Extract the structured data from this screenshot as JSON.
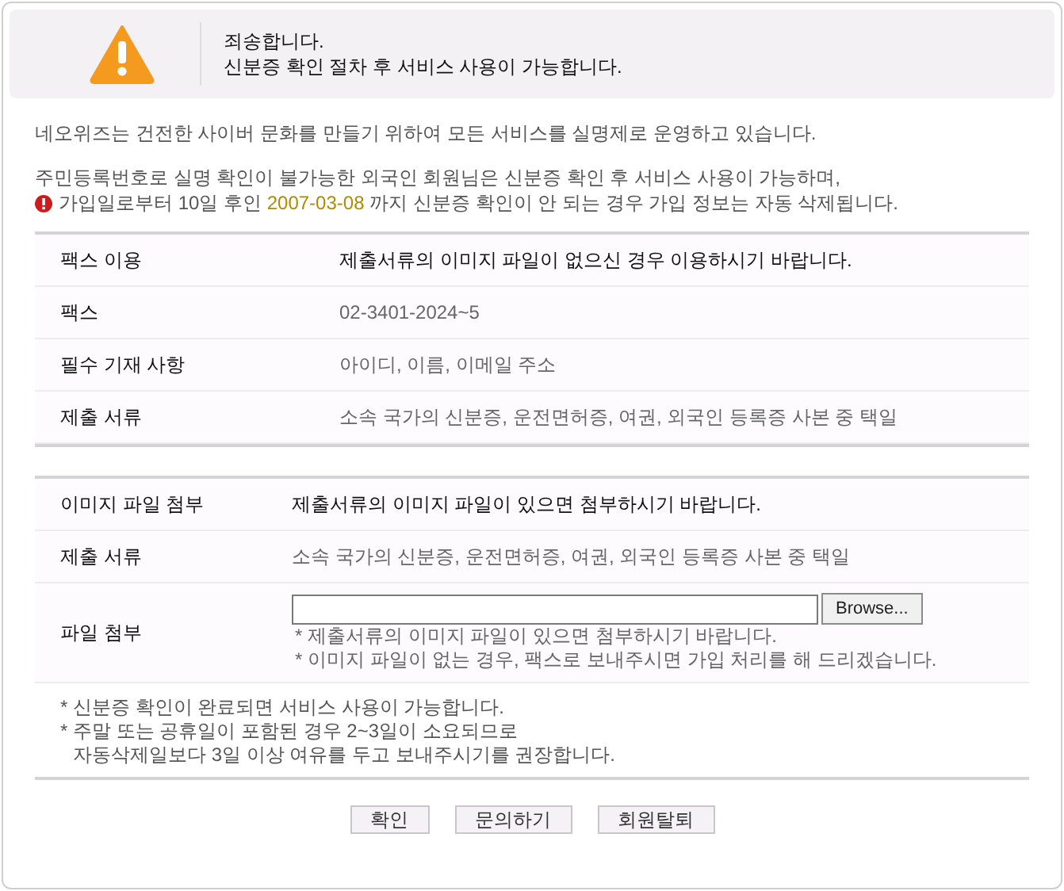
{
  "header": {
    "title": "죄송합니다.",
    "message": "신분증 확인 절차 후 서비스 사용이 가능합니다."
  },
  "intro": "네오위즈는 건전한 사이버 문화를 만들기 위하여 모든 서비스를 실명제로 운영하고 있습니다.",
  "notice": {
    "line1": "주민등록번호로 실명 확인이 불가능한 외국인 회원님은 신분증 확인 후 서비스 사용이 가능하며,",
    "before": "가입일로부터 10일 후인",
    "date": "2007-03-08",
    "after": "까지 신분증 확인이 안 되는 경우 가입 정보는 자동 삭제됩니다."
  },
  "fax_table": [
    {
      "label": "팩스 이용",
      "value": "제출서류의 이미지 파일이 없으신 경우 이용하시기 바랍니다.",
      "kind": "emphasis"
    },
    {
      "label": "팩스",
      "value": "02-3401-2024~5",
      "kind": "plain"
    },
    {
      "label": "필수 기재 사항",
      "value": "아이디, 이름, 이메일 주소",
      "kind": "plain"
    },
    {
      "label": "제출 서류",
      "value": "소속 국가의 신분증, 운전면허증, 여권, 외국인 등록증 사본 중 택일",
      "kind": "plain"
    }
  ],
  "upload_table": [
    {
      "label": "이미지 파일 첨부",
      "value": "제출서류의 이미지 파일이 있으면 첨부하시기 바랍니다.",
      "kind": "emphasis"
    },
    {
      "label": "제출 서류",
      "value": "소속 국가의 신분증, 운전면허증, 여권, 외국인 등록증 사본 중 택일",
      "kind": "plain"
    },
    {
      "label": "파일 첨부",
      "kind": "file",
      "browse": "Browse...",
      "hints": [
        "* 제출서류의 이미지 파일이 있으면 첨부하시기 바랍니다.",
        "* 이미지 파일이 없는 경우, 팩스로 보내주시면 가입 처리를 해 드리겠습니다."
      ]
    }
  ],
  "notes": [
    {
      "lines": [
        "* 신분증 확인이 완료되면 서비스 사용이 가능합니다."
      ]
    },
    {
      "lines": [
        "* 주말 또는 공휴일이 포함된 경우 2~3일이 소요되므로",
        "자동삭제일보다 3일 이상 여유를 두고 보내주시기를 권장합니다."
      ]
    }
  ],
  "buttons": [
    "확인",
    "문의하기",
    "회원탈퇴"
  ]
}
